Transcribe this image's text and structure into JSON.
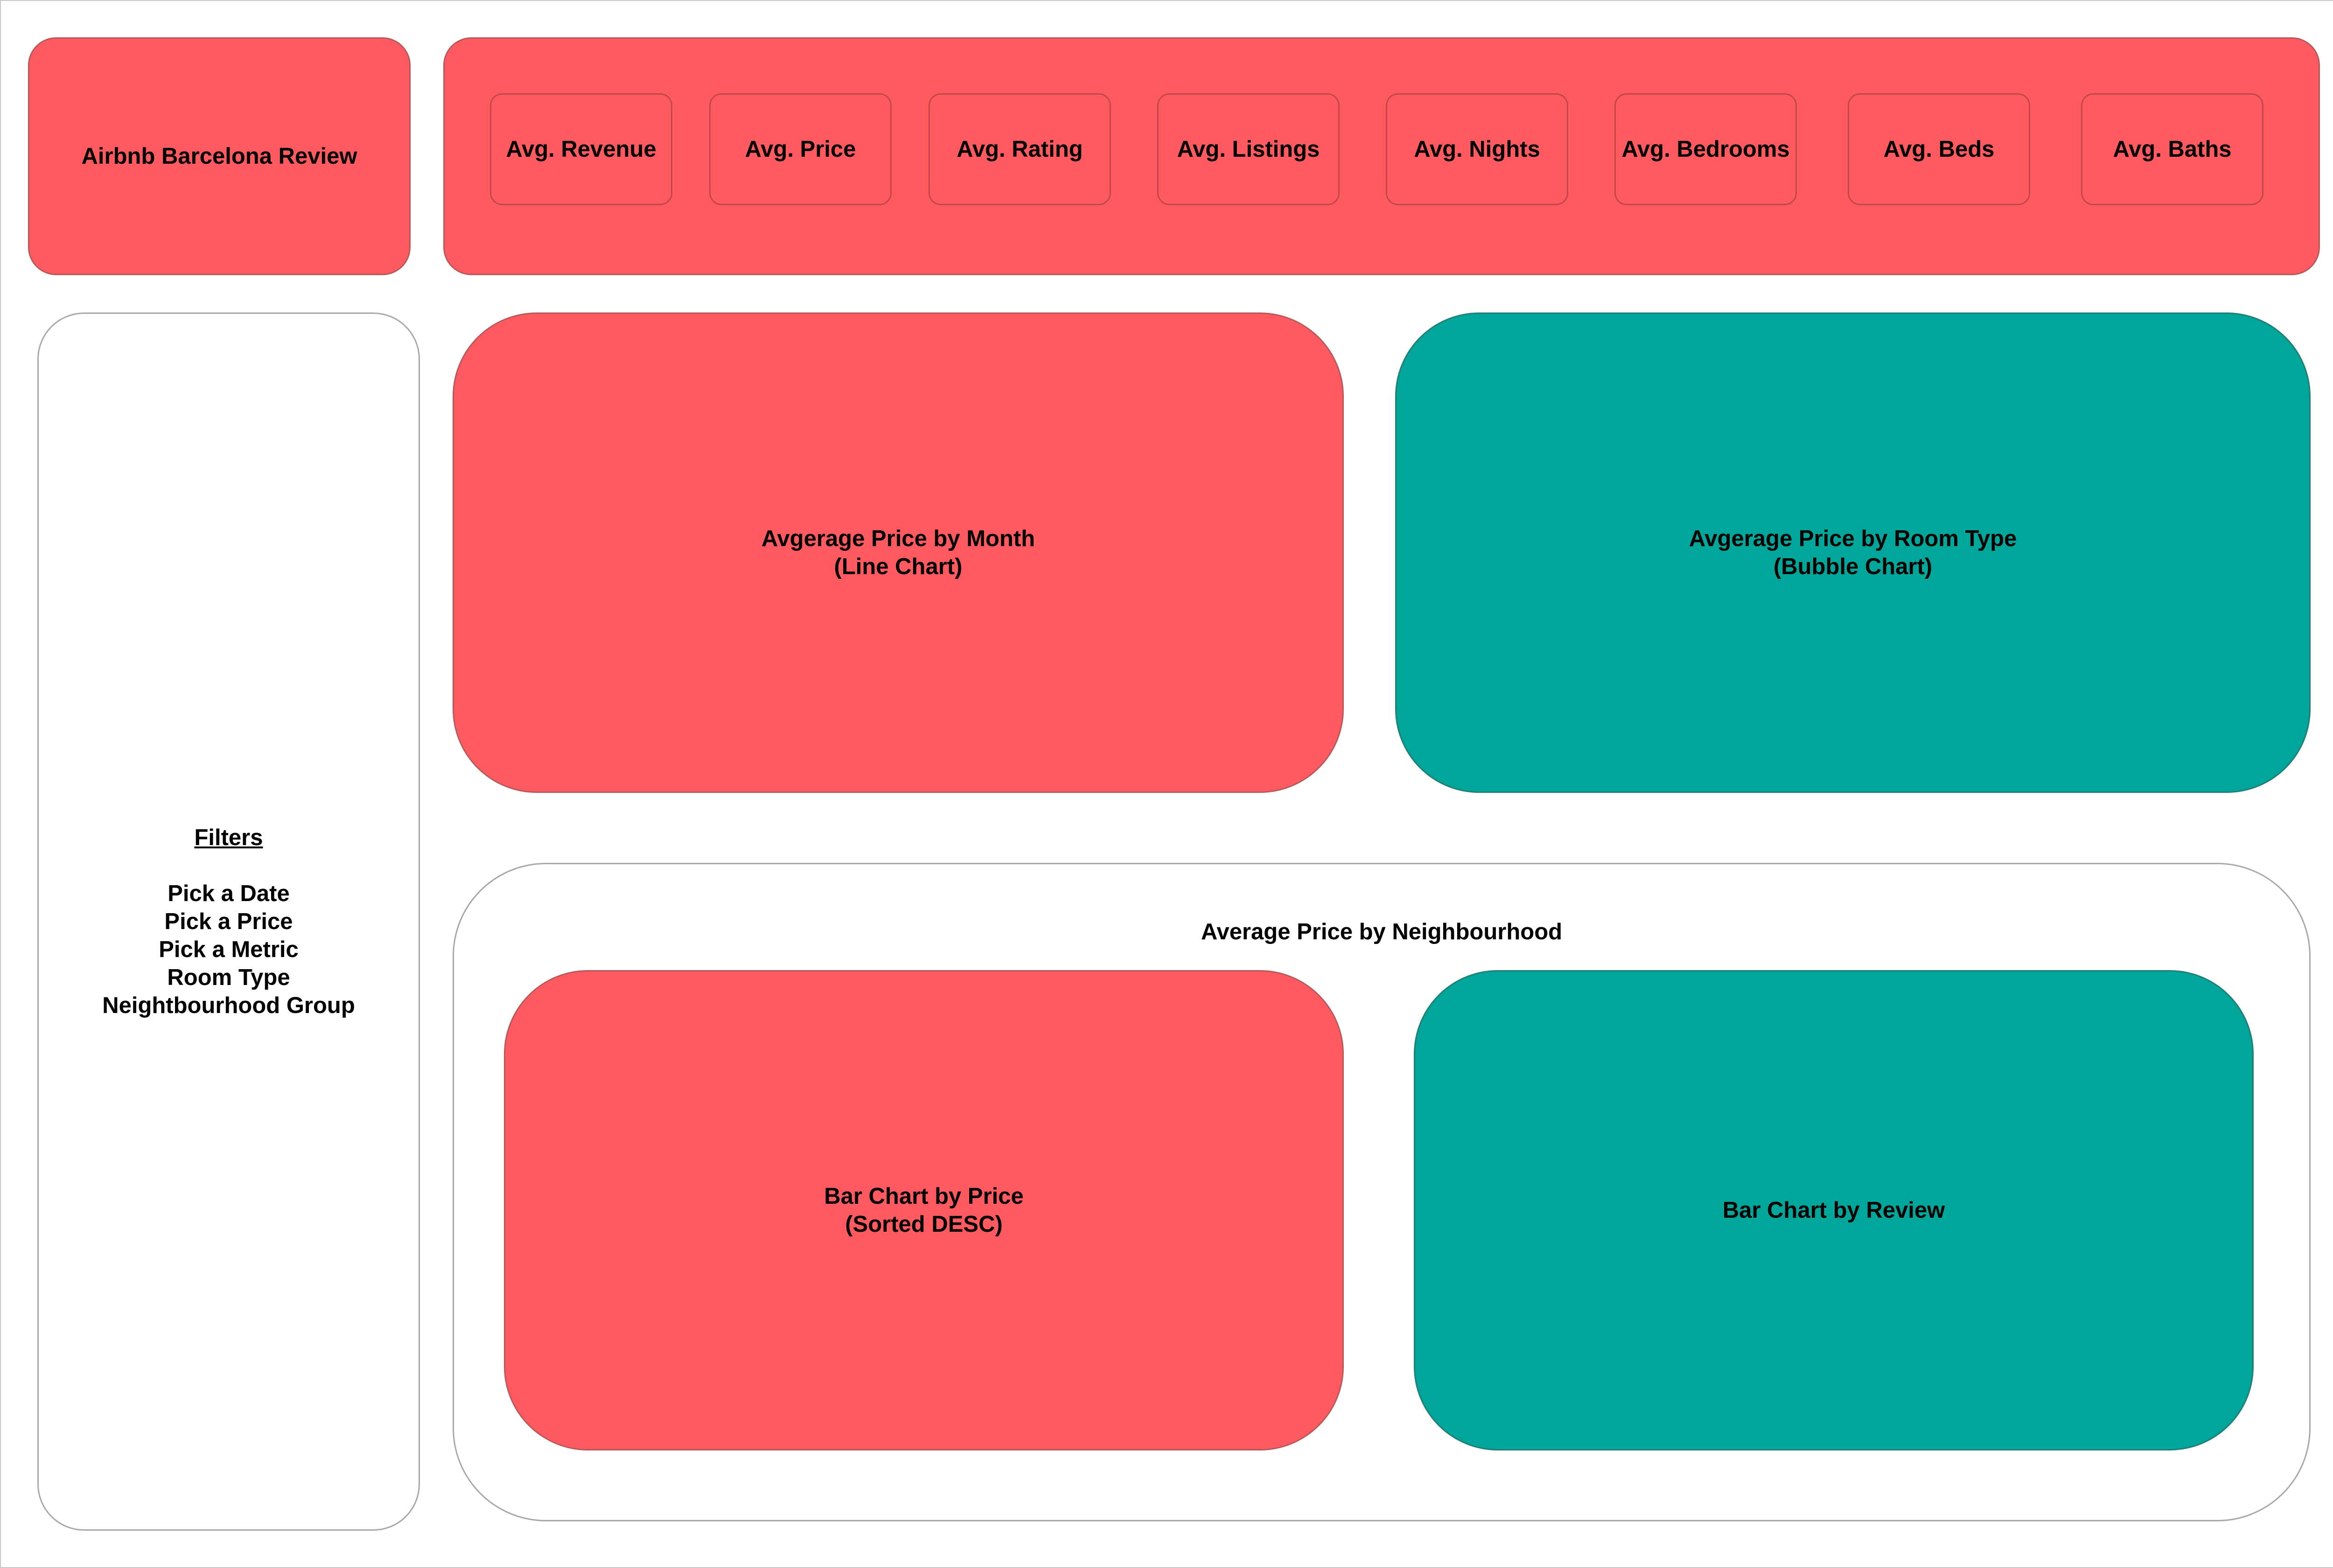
{
  "header": {
    "title": "Airbnb Barcelona Review"
  },
  "kpis": [
    {
      "label": "Avg. Revenue"
    },
    {
      "label": "Avg. Price"
    },
    {
      "label": "Avg. Rating"
    },
    {
      "label": "Avg. Listings"
    },
    {
      "label": "Avg. Nights"
    },
    {
      "label": "Avg. Bedrooms"
    },
    {
      "label": "Avg. Beds"
    },
    {
      "label": "Avg. Baths"
    }
  ],
  "filters": {
    "title": "Filters",
    "items": [
      "Pick a Date",
      "Pick a Price",
      "Pick a Metric",
      "Room Type",
      "Neightbourhood Group"
    ]
  },
  "charts": {
    "month": {
      "line1": "Avgerage Price by Month",
      "line2": "(Line Chart)"
    },
    "room_type": {
      "line1": "Avgerage Price by Room Type",
      "line2": "(Bubble Chart)"
    }
  },
  "neighbourhood": {
    "title": "Average Price by Neighbourhood",
    "price_chart": {
      "line1": "Bar Chart by Price",
      "line2": "(Sorted DESC)"
    },
    "review_chart": {
      "line1": "Bar Chart by Review"
    }
  },
  "colors": {
    "red": "#ff5a5f",
    "teal": "#00a699",
    "white": "#ffffff"
  }
}
